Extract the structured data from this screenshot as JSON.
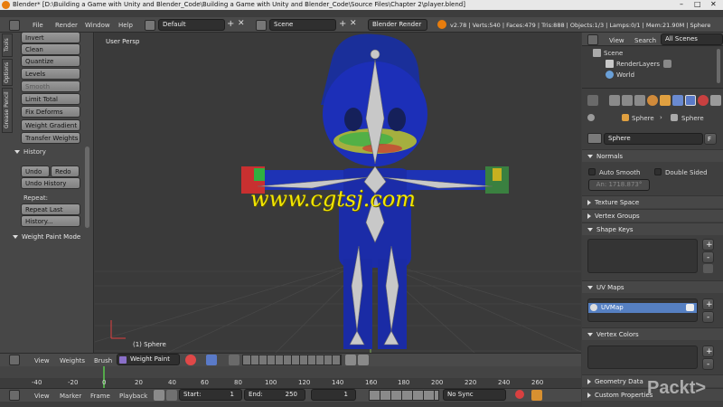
{
  "title_bar": {
    "title": "Blender* [D:\\Building a Game with Unity and Blender_Code\\Building a Game with Unity and Blender_Code\\Source Files\\Chapter 2\\player.blend]"
  },
  "menu": {
    "file": "File",
    "render": "Render",
    "window": "Window",
    "help": "Help",
    "layout": "Default",
    "scene": "Scene",
    "engine": "Blender Render",
    "stats": "v2.78 | Verts:540 | Faces:479 | Tris:888 | Objects:1/3 | Lamps:0/1 | Mem:21.90M | Sphere"
  },
  "tool_shelf": {
    "tabs": [
      "Tools",
      "Options",
      "Grease Pencil"
    ],
    "buttons": [
      "Invert",
      "Clean",
      "Quantize",
      "Levels",
      "Smooth",
      "Limit Total",
      "Fix Deforms",
      "Weight Gradient",
      "Transfer Weights"
    ],
    "history_header": "History",
    "undo": "Undo",
    "redo": "Redo",
    "undo_history": "Undo History",
    "repeat_label": "Repeat:",
    "repeat_last": "Repeat Last",
    "history_more": "History...",
    "mode_header": "Weight Paint Mode"
  },
  "viewport": {
    "view_label": "User Persp",
    "object_label": "(1) Sphere",
    "watermark": "www.cgtsj.com"
  },
  "view3d_header": {
    "view": "View",
    "weights": "Weights",
    "brush": "Brush",
    "mode": "Weight Paint"
  },
  "timeline": {
    "ticks": [
      "-40",
      "-20",
      "0",
      "20",
      "40",
      "60",
      "80",
      "100",
      "120",
      "140",
      "160",
      "180",
      "200",
      "220",
      "240",
      "260"
    ],
    "view": "View",
    "marker": "Marker",
    "frame": "Frame",
    "playback": "Playback",
    "start_label": "Start:",
    "start_value": "1",
    "end_label": "End:",
    "end_value": "250",
    "current": "1",
    "sync": "No Sync"
  },
  "outliner": {
    "view": "View",
    "search": "Search",
    "all_scenes": "All Scenes",
    "items": [
      "Scene",
      "RenderLayers",
      "World"
    ]
  },
  "properties": {
    "breadcrumb_a": "Sphere",
    "breadcrumb_b": "Sphere",
    "mesh_name": "Sphere",
    "fake_user": "F",
    "normals": "Normals",
    "auto_smooth": "Auto Smooth",
    "double_sided": "Double Sided",
    "angle": "An: 1718.873°",
    "texture_space": "Texture Space",
    "vertex_groups": "Vertex Groups",
    "shape_keys": "Shape Keys",
    "uv_maps": "UV Maps",
    "uv_map_name": "UVMap",
    "vertex_colors": "Vertex Colors",
    "geometry_data": "Geometry Data",
    "custom_properties": "Custom Properties"
  },
  "branding": {
    "logo": "Packt>"
  },
  "colors": {
    "accent_blue": "#5680c2",
    "watermark_yellow": "#f2e600",
    "viewport_bg": "#3a3a3a"
  }
}
